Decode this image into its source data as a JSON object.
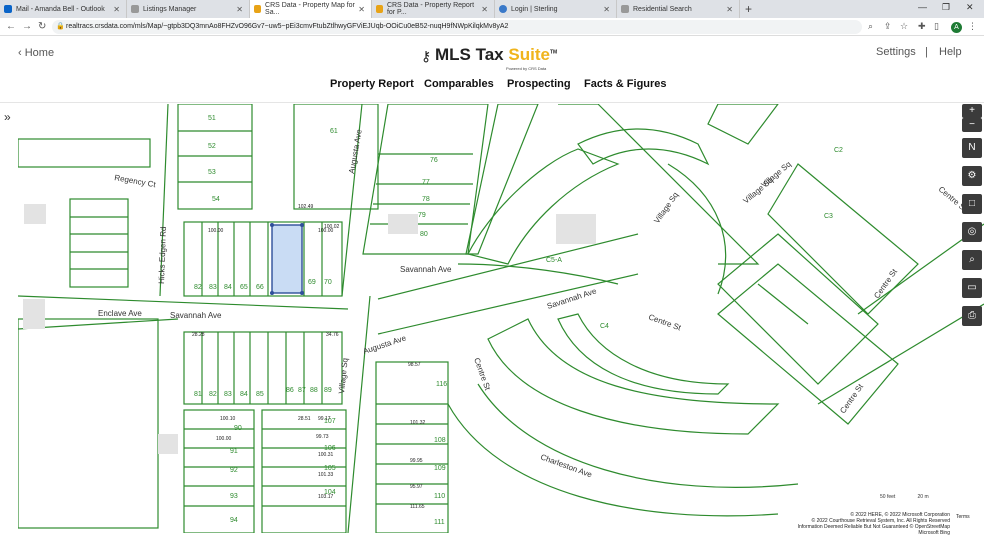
{
  "browser": {
    "tabs": [
      {
        "label": "Mail - Amanda Bell - Outlook"
      },
      {
        "label": "Listings Manager"
      },
      {
        "label": "CRS Data - Property Map for Sa..."
      },
      {
        "label": "CRS Data - Property Report for P..."
      },
      {
        "label": "Login | Sterling"
      },
      {
        "label": "Residential Search"
      }
    ],
    "url": "realtracs.crsdata.com/mls/Map/~gtpb3DQ3mnAo8FHZvO96Gv7~uw5~pEi3cmvFtubZtlhwyGFViEJUqb-OOiCu0eB52-nuqH9fNWpKilqkMv8yA2",
    "avatar_initial": "A"
  },
  "header": {
    "home_label": "Home",
    "logo_text": "MLS Tax",
    "logo_highlight": "Suite",
    "logo_tm": "TM",
    "logo_sub": "Powered by CRS Data",
    "settings_label": "Settings",
    "separator": "|",
    "help_label": "Help",
    "nav": [
      {
        "label": "Property Report"
      },
      {
        "label": "Comparables"
      },
      {
        "label": "Prospecting"
      },
      {
        "label": "Facts & Figures"
      }
    ]
  },
  "map": {
    "streets": [
      "Hicks Edgen Rd",
      "Regency Ct",
      "Enclave Ave",
      "Savannah Ave",
      "Savannah Ave",
      "Savannah Ave",
      "Augusta Ave",
      "Augusta Ave",
      "Village Sq",
      "Village Sq",
      "Village Sq",
      "Village Sq",
      "Centre St",
      "Centre St",
      "Centre St",
      "Centre St",
      "Centre St",
      "Charleston Ave"
    ],
    "lot_numbers": [
      "51",
      "52",
      "53",
      "54",
      "61",
      "76",
      "77",
      "78",
      "79",
      "80",
      "82",
      "83",
      "84",
      "65",
      "66",
      "69",
      "70",
      "81",
      "82",
      "83",
      "84",
      "85",
      "86",
      "87",
      "88",
      "89",
      "90",
      "91",
      "92",
      "93",
      "94",
      "104",
      "105",
      "106",
      "107",
      "108",
      "109",
      "110",
      "111",
      "116",
      "C2",
      "C3",
      "C4",
      "C5-A"
    ],
    "dims": [
      "102.49",
      "100.00",
      "100.00",
      "100.10",
      "100.00",
      "99.17",
      "99.73",
      "100.31",
      "101.33",
      "103.17",
      "101.32",
      "99.95",
      "95.97",
      "111.65",
      "98.57",
      "28.51",
      "28.28",
      "34.76",
      "100.02"
    ],
    "scale_label": "50 feet",
    "scale_label2": "20 m",
    "attribution": [
      "© 2022 HERE, © 2022 Microsoft Corporation",
      "© 2022 Courthouse Retrieval System, Inc. All Rights Reserved",
      "Information Deemed Reliable But Not Guaranteed © OpenStreetMap Microsoft Bing"
    ],
    "terms": "Terms"
  },
  "tools": [
    {
      "icon": "zoom-in-icon",
      "glyph": "+"
    },
    {
      "icon": "zoom-out-icon",
      "glyph": "−"
    },
    {
      "icon": "compass-icon",
      "glyph": "N"
    },
    {
      "icon": "gear-icon",
      "glyph": "⚙"
    },
    {
      "icon": "square-icon",
      "glyph": "□"
    },
    {
      "icon": "locate-icon",
      "glyph": "◎"
    },
    {
      "icon": "search-icon",
      "glyph": "⌕"
    },
    {
      "icon": "ruler-icon",
      "glyph": "▭"
    },
    {
      "icon": "print-icon",
      "glyph": "⎙"
    }
  ]
}
